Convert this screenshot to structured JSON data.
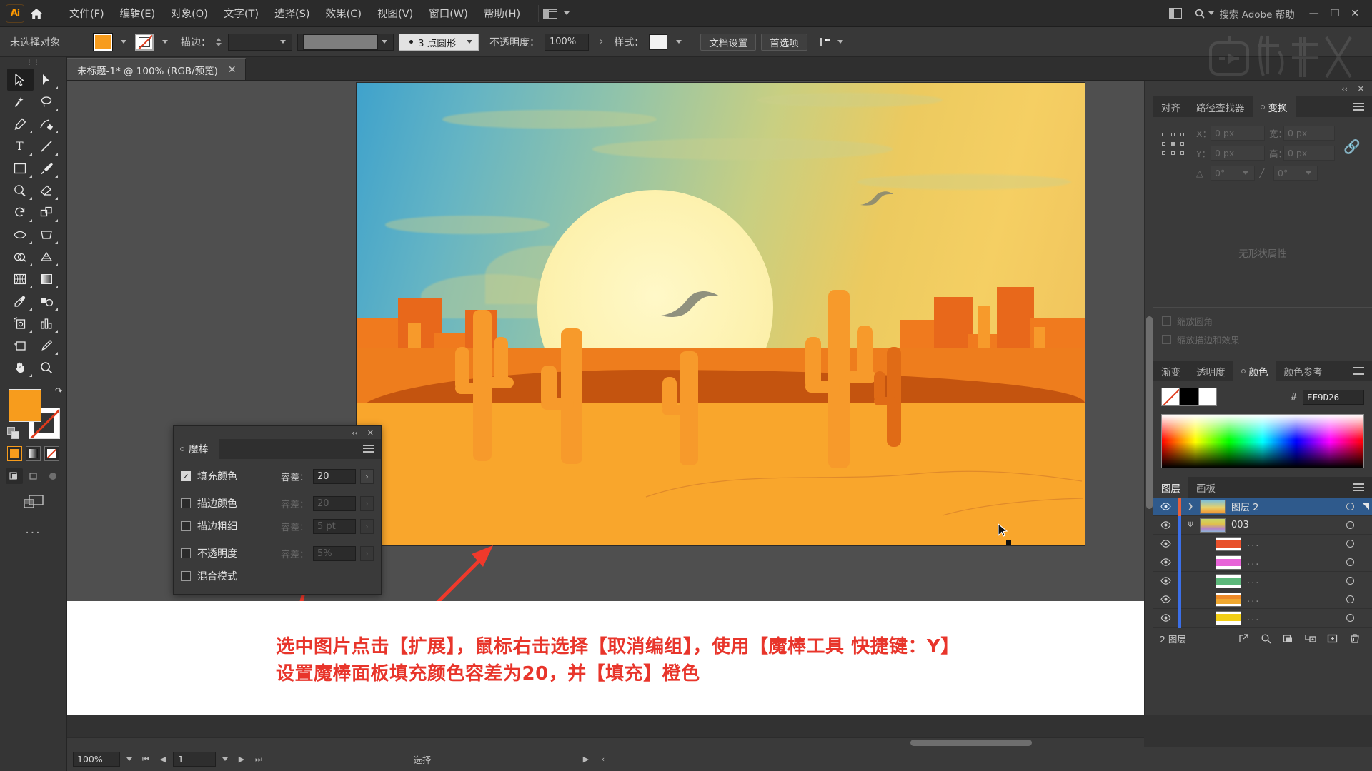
{
  "app": {
    "logo": "Ai",
    "home_icon": "home-icon"
  },
  "menubar": {
    "items": [
      "文件(F)",
      "编辑(E)",
      "对象(O)",
      "文字(T)",
      "选择(S)",
      "效果(C)",
      "视图(V)",
      "窗口(W)",
      "帮助(H)"
    ],
    "workspace_icon": "workspace-switcher-icon",
    "search_placeholder": "搜索 Adobe 帮助",
    "search_icon": "search-icon",
    "panel_toggle_icon": "panel-toggle-icon",
    "minimize": "—",
    "restore": "❐",
    "close": "✕"
  },
  "controlbar": {
    "selection_status": "未选择对象",
    "fill_swatch_color": "#F79C1D",
    "stroke_label": "描边：",
    "stroke_width_value": "",
    "brush_label": "3 点圆形",
    "opacity_label": "不透明度：",
    "opacity_value": "100%",
    "style_label": "样式：",
    "doc_setup_button": "文档设置",
    "preferences_button": "首选项",
    "align_icon": "align-to-selection-icon"
  },
  "document_tab": {
    "title": "未标题-1* @ 100% (RGB/预览)",
    "close_icon": "close-icon"
  },
  "toolbar": {
    "tools": [
      {
        "name": "selection-tool",
        "active": true
      },
      {
        "name": "direct-selection-tool",
        "active": false
      },
      {
        "name": "magic-wand-tool",
        "active": false
      },
      {
        "name": "lasso-tool",
        "active": false
      },
      {
        "name": "pen-tool",
        "active": false
      },
      {
        "name": "curvature-tool",
        "active": false
      },
      {
        "name": "type-tool",
        "active": false
      },
      {
        "name": "line-segment-tool",
        "active": false
      },
      {
        "name": "rectangle-tool",
        "active": false
      },
      {
        "name": "paintbrush-tool",
        "active": false
      },
      {
        "name": "shaper-tool",
        "active": false
      },
      {
        "name": "eraser-tool",
        "active": false
      },
      {
        "name": "rotate-tool",
        "active": false
      },
      {
        "name": "scale-tool",
        "active": false
      },
      {
        "name": "width-tool",
        "active": false
      },
      {
        "name": "free-transform-tool",
        "active": false
      },
      {
        "name": "shape-builder-tool",
        "active": false
      },
      {
        "name": "perspective-grid-tool",
        "active": false
      },
      {
        "name": "mesh-tool",
        "active": false
      },
      {
        "name": "gradient-tool",
        "active": false
      },
      {
        "name": "eyedropper-tool",
        "active": false
      },
      {
        "name": "blend-tool",
        "active": false
      },
      {
        "name": "symbol-sprayer-tool",
        "active": false
      },
      {
        "name": "column-graph-tool",
        "active": false
      },
      {
        "name": "artboard-tool",
        "active": false
      },
      {
        "name": "slice-tool",
        "active": false
      },
      {
        "name": "hand-tool",
        "active": false
      },
      {
        "name": "zoom-tool",
        "active": false
      }
    ],
    "fill_color": "#F79C1D",
    "stroke_color": "none",
    "swap_icon": "swap-fill-stroke-icon",
    "default_icon": "default-fill-stroke-icon",
    "modes": [
      "color-swatch-mode",
      "gradient-mode",
      "none-mode"
    ],
    "draw_modes": [
      "draw-normal",
      "draw-behind",
      "draw-inside"
    ],
    "screen_mode_icon": "screen-mode-icon",
    "more_tools": "..."
  },
  "magic_wand_panel": {
    "tab_label": "魔棒",
    "collapse_icon": "collapse-icon",
    "close_icon": "close-icon",
    "menu_icon": "panel-menu-icon",
    "rows": [
      {
        "label": "填充颜色",
        "checked": true,
        "tol_label": "容差：",
        "tol_value": "20",
        "enabled": true
      },
      {
        "label": "描边颜色",
        "checked": false,
        "tol_label": "容差：",
        "tol_value": "20",
        "enabled": false
      },
      {
        "label": "描边粗细",
        "checked": false,
        "tol_label": "容差：",
        "tol_value": "5 pt",
        "enabled": false
      },
      {
        "label": "不透明度",
        "checked": false,
        "tol_label": "容差：",
        "tol_value": "5%",
        "enabled": false
      },
      {
        "label": "混合模式",
        "checked": false,
        "tol_label": "",
        "tol_value": "",
        "enabled": false
      }
    ]
  },
  "caption": {
    "line1": "选中图片点击【扩展】，鼠标右击选择【取消编组】，使用【魔棒工具 快捷键：Y】",
    "line2": "设置魔棒面板填充颜色容差为20，并【填充】橙色",
    "color": "#E8352B"
  },
  "right_panels": {
    "transform": {
      "tabs": [
        {
          "label": "对齐",
          "active": false
        },
        {
          "label": "路径查找器",
          "active": false
        },
        {
          "label": "变换",
          "active": true
        }
      ],
      "x_label": "X：",
      "x_value": "0 px",
      "y_label": "Y：",
      "y_value": "0 px",
      "w_label": "宽：",
      "w_value": "0 px",
      "h_label": "高：",
      "h_value": "0 px",
      "angle_label": "角度",
      "angle_value": "0°",
      "shear_label": "斜切",
      "shear_value": "0°",
      "link_icon": "constrain-proportions-icon",
      "reference_point_icon": "reference-point-grid-icon",
      "empty_text": "无形状属性",
      "check_scale_corners": "缩放圆角",
      "check_scale_strokes": "缩放描边和效果"
    },
    "color": {
      "tabs": [
        {
          "label": "渐变",
          "active": false
        },
        {
          "label": "透明度",
          "active": false
        },
        {
          "label": "颜色",
          "active": true
        },
        {
          "label": "颜色参考",
          "active": false
        }
      ],
      "hex_symbol": "#",
      "hex_value": "EF9D26",
      "fill_color": "#EF9D26",
      "none_swatch": "none-swatch",
      "black_swatch": "#000000",
      "white_swatch": "#FFFFFF"
    },
    "layers": {
      "tabs": [
        {
          "label": "图层",
          "active": true
        },
        {
          "label": "画板",
          "active": false
        }
      ],
      "rows": [
        {
          "name": "图层 2",
          "selected": true,
          "indent": 0,
          "expander": "›",
          "bar": "#E8603B",
          "thumb": "sunset-thumb",
          "eye": "visible"
        },
        {
          "name": "003",
          "selected": false,
          "indent": 1,
          "expander": "⌄",
          "bar": "#3B6FE8",
          "thumb": "group-thumb",
          "eye": "visible"
        },
        {
          "name": "...",
          "selected": false,
          "indent": 2,
          "expander": "",
          "bar": "#3B6FE8",
          "thumb": "#E8502A",
          "eye": "visible"
        },
        {
          "name": "...",
          "selected": false,
          "indent": 2,
          "expander": "",
          "bar": "#3B6FE8",
          "thumb": "#E864D8",
          "eye": "visible"
        },
        {
          "name": "...",
          "selected": false,
          "indent": 2,
          "expander": "",
          "bar": "#3B6FE8",
          "thumb": "#5CB87A",
          "eye": "visible"
        },
        {
          "name": "...",
          "selected": false,
          "indent": 2,
          "expander": "",
          "bar": "#3B6FE8",
          "thumb": "#F0A830",
          "eye": "visible"
        },
        {
          "name": "...",
          "selected": false,
          "indent": 2,
          "expander": "",
          "bar": "#3B6FE8",
          "thumb": "#F2CE16",
          "eye": "visible"
        }
      ],
      "footer_count": "2 图层",
      "footer_icons": [
        "locate-object-icon",
        "search-layer-icon",
        "make-clipping-mask-icon",
        "create-sublayer-icon",
        "create-new-layer-icon",
        "delete-layer-icon"
      ]
    }
  },
  "statusbar": {
    "zoom_value": "100%",
    "page_value": "1",
    "status_text": "选择",
    "first_icon": "first-page-icon",
    "prev_icon": "prev-page-icon",
    "next_icon": "next-page-icon",
    "last_icon": "last-page-icon"
  },
  "artwork": {
    "title": "desert-sunset-illustration",
    "sky_top": "#3FA2CC",
    "sky_mid": "#C8CF82",
    "sky_bottom": "#F5CF63",
    "sun_color": "#FDF2B0",
    "sand_color": "#F9A62C",
    "shadow_color": "#C4540F",
    "mesa_color": "#F07A1E",
    "cactus_color": "#F79A2B"
  },
  "watermark": {
    "text": "虎课网"
  }
}
